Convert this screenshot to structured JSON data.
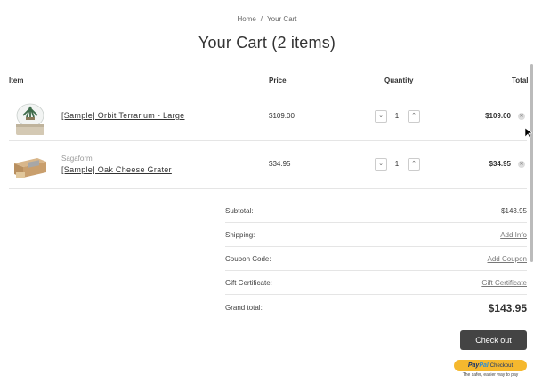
{
  "breadcrumb": {
    "home": "Home",
    "separator": "/",
    "current": "Your Cart"
  },
  "page_title": "Your Cart (2 items)",
  "table_headers": {
    "item": "Item",
    "price": "Price",
    "quantity": "Quantity",
    "total": "Total"
  },
  "items": [
    {
      "brand": "",
      "name": "[Sample] Orbit Terrarium - Large",
      "price": "$109.00",
      "quantity": "1",
      "total": "$109.00",
      "thumb_icon": "terrarium-image"
    },
    {
      "brand": "Sagaform",
      "name": "[Sample] Oak Cheese Grater",
      "price": "$34.95",
      "quantity": "1",
      "total": "$34.95",
      "thumb_icon": "cheese-grater-image"
    }
  ],
  "summary": {
    "subtotal_label": "Subtotal:",
    "subtotal_value": "$143.95",
    "shipping_label": "Shipping:",
    "shipping_link": "Add Info",
    "coupon_label": "Coupon Code:",
    "coupon_link": "Add Coupon",
    "gift_label": "Gift Certificate:",
    "gift_link": "Gift Certificate",
    "grand_label": "Grand total:",
    "grand_value": "$143.95"
  },
  "checkout_label": "Check out",
  "paypal": {
    "brand_pay": "Pay",
    "brand_pal": "Pal",
    "button_text": "Checkout",
    "tagline": "The safer, easier way to pay"
  },
  "icons": {
    "decrease": "chevron-down-icon",
    "increase": "chevron-up-icon",
    "remove": "close-icon"
  },
  "colors": {
    "checkout_bg": "#444444",
    "paypal_bg": "#f5b82e"
  }
}
